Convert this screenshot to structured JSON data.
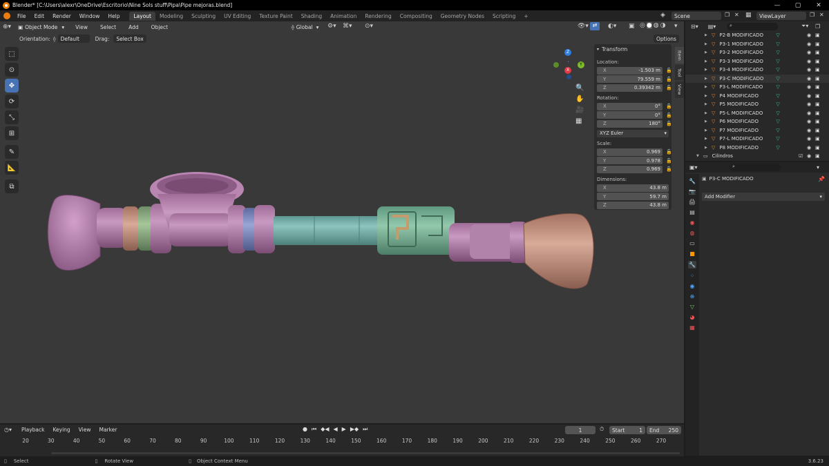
{
  "titlebar": {
    "title": "Blender* [C:\\Users\\alexr\\OneDrive\\Escritorio\\Nine Sols stuff\\Pipa\\Pipe mejoras.blend]",
    "controls": [
      "—",
      "▢",
      "✕"
    ]
  },
  "menus": [
    "File",
    "Edit",
    "Render",
    "Window",
    "Help"
  ],
  "workspaces": [
    "Layout",
    "Modeling",
    "Sculpting",
    "UV Editing",
    "Texture Paint",
    "Shading",
    "Animation",
    "Rendering",
    "Compositing",
    "Geometry Nodes",
    "Scripting"
  ],
  "active_workspace": "Layout",
  "add_workspace": "+",
  "scene": {
    "name": "Scene",
    "view_layer": "ViewLayer"
  },
  "viewport_header": {
    "mode": "Object Mode",
    "menus": [
      "View",
      "Select",
      "Add",
      "Object"
    ],
    "transform_orientation": "Global",
    "options": "Options"
  },
  "viewport_subheader": {
    "orientation_label": "Orientation:",
    "orientation_value": "Default",
    "drag_label": "Drag:",
    "drag_value": "Select Box"
  },
  "gizmo": {
    "z": "Z",
    "y": "Y",
    "x": "X"
  },
  "npanel": {
    "header": "Transform",
    "location_label": "Location:",
    "location": [
      {
        "axis": "X",
        "value": "-1.503 m"
      },
      {
        "axis": "Y",
        "value": "79.559 m"
      },
      {
        "axis": "Z",
        "value": "0.39342 m"
      }
    ],
    "rotation_label": "Rotation:",
    "rotation": [
      {
        "axis": "X",
        "value": "0°"
      },
      {
        "axis": "Y",
        "value": "0°"
      },
      {
        "axis": "Z",
        "value": "180°"
      }
    ],
    "rotation_mode": "XYZ Euler",
    "scale_label": "Scale:",
    "scale": [
      {
        "axis": "X",
        "value": "0.969"
      },
      {
        "axis": "Y",
        "value": "0.978"
      },
      {
        "axis": "Z",
        "value": "0.969"
      }
    ],
    "dimensions_label": "Dimensions:",
    "dimensions": [
      {
        "axis": "X",
        "value": "43.8 m"
      },
      {
        "axis": "Y",
        "value": "59.7 m"
      },
      {
        "axis": "Z",
        "value": "43.8 m"
      }
    ]
  },
  "side_tabs": [
    "Item",
    "Tool",
    "View"
  ],
  "outliner": {
    "items": [
      "P2-B MODIFICADO",
      "P3-1 MODIFICADO",
      "P3-2 MODIFICADO",
      "P3-3 MODIFICADO",
      "P3-4 MODIFICADO",
      "P3-C MODIFICADO",
      "P3-L MODIFICADO",
      "P4 MODIFICADO",
      "P5 MODIFICADO",
      "P5-L MODIFICADO",
      "P6 MODIFICADO",
      "P7 MODIFICADO",
      "P7-L MODIFICADO",
      "P8 MODIFICADO"
    ],
    "selected": "P3-C MODIFICADO",
    "collection": "Cilindros"
  },
  "properties": {
    "object_name": "P3-C MODIFICADO",
    "add_modifier": "Add Modifier"
  },
  "timeline": {
    "menus": [
      "Playback",
      "Keying",
      "View",
      "Marker"
    ],
    "current_frame": "1",
    "start_label": "Start",
    "start": "1",
    "end_label": "End",
    "end": "250",
    "ticks": [
      "20",
      "30",
      "40",
      "50",
      "60",
      "70",
      "80",
      "90",
      "100",
      "110",
      "120",
      "130",
      "140",
      "150",
      "160",
      "170",
      "180",
      "190",
      "200",
      "210",
      "220",
      "230",
      "240",
      "250",
      "260",
      "270"
    ]
  },
  "statusbar": {
    "select": "Select",
    "rotate": "Rotate View",
    "context": "Object Context Menu",
    "version": "3.6.23"
  },
  "colors": {
    "accent": "#4772b3",
    "pink": "#b07ba8",
    "teal": "#6fa9a4",
    "tan": "#c49282",
    "green": "#8aa97f",
    "blue": "#7884b8"
  }
}
